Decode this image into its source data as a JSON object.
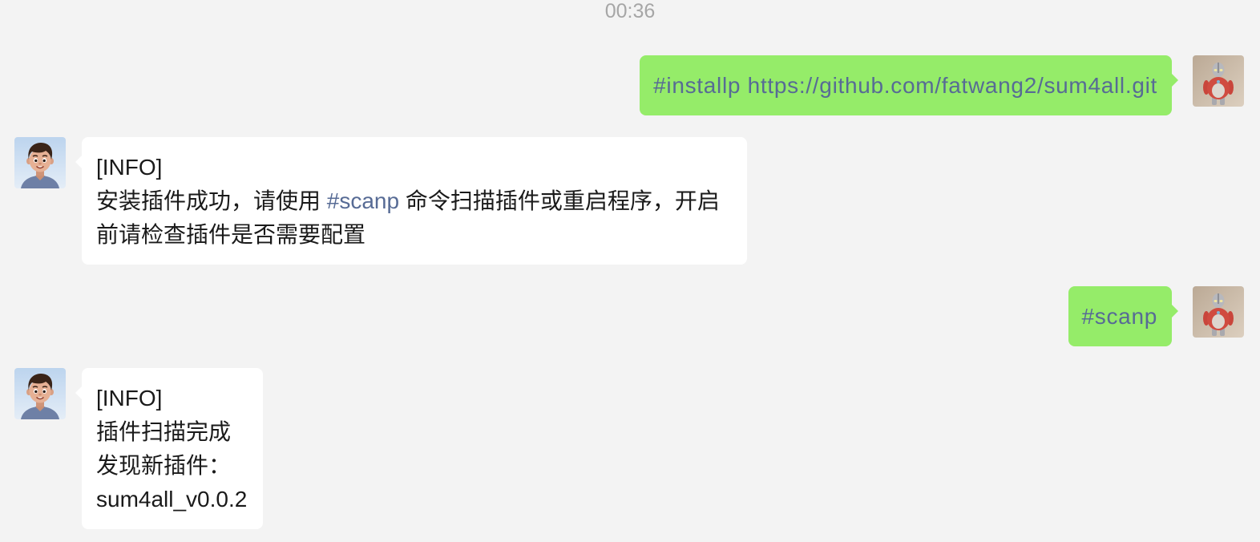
{
  "colors": {
    "background": "#f3f3f3",
    "sent_bubble": "#95ec69",
    "received_bubble": "#ffffff",
    "link": "#576b95",
    "text": "#1a1a1a",
    "timestamp": "#a6a6a6"
  },
  "chat": {
    "timestamp": "00:36",
    "messages": [
      {
        "avatar_icon": "ultraman-figure-avatar-icon",
        "text": "#installp https://github.com/fatwang2/sum4all.git"
      },
      {
        "avatar_icon": "cartoon-boy-avatar-icon",
        "header": "[INFO]",
        "body": {
          "before_link": "安装插件成功，请使用 ",
          "link": "#scanp",
          "after_link": " 命令扫描插件或重启程序，开启前请检查插件是否需要配置"
        }
      },
      {
        "avatar_icon": "ultraman-figure-avatar-icon",
        "text": "#scanp"
      },
      {
        "avatar_icon": "cartoon-boy-avatar-icon",
        "lines": [
          "[INFO]",
          "插件扫描完成",
          "发现新插件：",
          "sum4all_v0.0.2"
        ]
      }
    ]
  }
}
